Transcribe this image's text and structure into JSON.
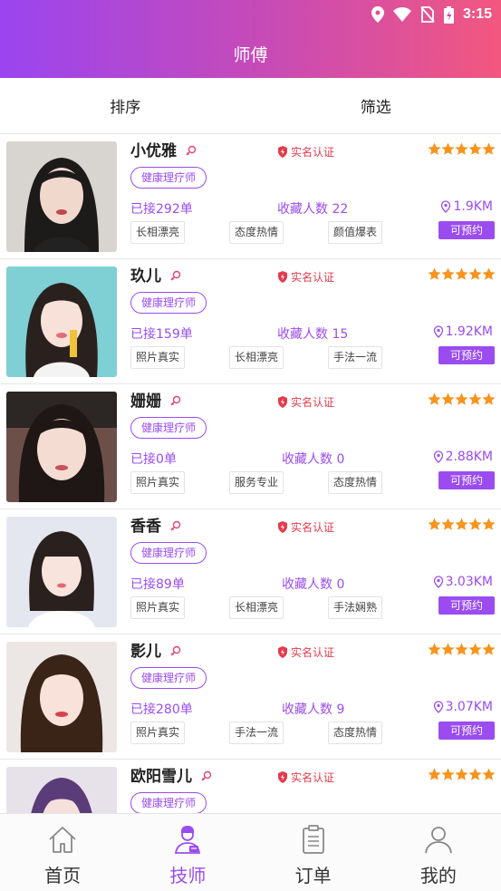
{
  "statusbar": {
    "time": "3:15"
  },
  "header": {
    "title": "师傅"
  },
  "filters": {
    "sort_label": "排序",
    "filter_label": "筛选"
  },
  "colors": {
    "accent": "#9a4cf0",
    "verified": "#e53a4c",
    "star": "#f7941e"
  },
  "technicians": [
    {
      "name": "小优雅",
      "verified": "实名认证",
      "stars": 5,
      "role": "健康理疗师",
      "orders": "已接292单",
      "favorites": "收藏人数 22",
      "distance": "1.9KM",
      "tags": [
        "长相漂亮",
        "态度热情",
        "颜值爆表"
      ],
      "book": "可预约"
    },
    {
      "name": "玖儿",
      "verified": "实名认证",
      "stars": 5,
      "role": "健康理疗师",
      "orders": "已接159单",
      "favorites": "收藏人数 15",
      "distance": "1.92KM",
      "tags": [
        "照片真实",
        "长相漂亮",
        "手法一流"
      ],
      "book": "可预约"
    },
    {
      "name": "姗姗",
      "verified": "实名认证",
      "stars": 5,
      "role": "健康理疗师",
      "orders": "已接0单",
      "favorites": "收藏人数 0",
      "distance": "2.88KM",
      "tags": [
        "照片真实",
        "服务专业",
        "态度热情"
      ],
      "book": "可预约"
    },
    {
      "name": "香香",
      "verified": "实名认证",
      "stars": 5,
      "role": "健康理疗师",
      "orders": "已接89单",
      "favorites": "收藏人数 0",
      "distance": "3.03KM",
      "tags": [
        "照片真实",
        "长相漂亮",
        "手法娴熟"
      ],
      "book": "可预约"
    },
    {
      "name": "影儿",
      "verified": "实名认证",
      "stars": 5,
      "role": "健康理疗师",
      "orders": "已接280单",
      "favorites": "收藏人数 9",
      "distance": "3.07KM",
      "tags": [
        "照片真实",
        "手法一流",
        "态度热情"
      ],
      "book": "可预约"
    },
    {
      "name": "欧阳雪儿",
      "verified": "实名认证",
      "stars": 5,
      "role": "健康理疗师",
      "orders": "",
      "favorites": "",
      "distance": "",
      "tags": [],
      "book": ""
    }
  ],
  "tabbar": [
    {
      "label": "首页",
      "icon": "home-icon",
      "active": false
    },
    {
      "label": "技师",
      "icon": "technician-icon",
      "active": true
    },
    {
      "label": "订单",
      "icon": "order-icon",
      "active": false
    },
    {
      "label": "我的",
      "icon": "profile-icon",
      "active": false
    }
  ]
}
